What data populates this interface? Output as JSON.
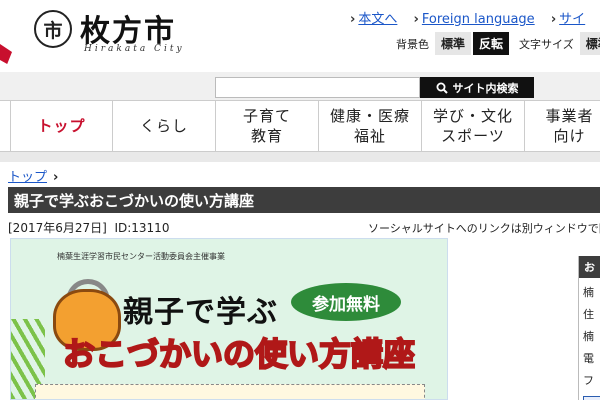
{
  "header": {
    "logo_mark": "市",
    "logo_text": "枚方市",
    "logo_sub": "Hirakata City",
    "links": [
      {
        "label": "本文へ"
      },
      {
        "label": "Foreign language"
      },
      {
        "label": "サイ"
      }
    ],
    "bg_color_label": "背景色",
    "bg_standard": "標準",
    "bg_reverse": "反転",
    "font_size_label": "文字サイズ",
    "font_standard": "標準"
  },
  "search": {
    "input_value": "",
    "button_label": "サイト内検索"
  },
  "nav": [
    {
      "line1": "トップ",
      "line2": ""
    },
    {
      "line1": "くらし",
      "line2": ""
    },
    {
      "line1": "子育て",
      "line2": "教育"
    },
    {
      "line1": "健康・医療",
      "line2": "福祉"
    },
    {
      "line1": "学び・文化",
      "line2": "スポーツ"
    },
    {
      "line1": "事業者",
      "line2": "向け"
    }
  ],
  "breadcrumb": {
    "home": "トップ",
    "sep": "›"
  },
  "page": {
    "title": "親子で学ぶおこづかいの使い方講座",
    "date": "[2017年6月27日]",
    "id": "ID:13110",
    "social_note": "ソーシャルサイトへのリンクは別ウィンドウで開き"
  },
  "flyer": {
    "organizer": "楠葉生涯学習市民センター活動委員会主催事業",
    "heading1": "親子で学ぶ",
    "badge": "参加無料",
    "heading2": "おこづかいの使い方講座"
  },
  "sidebar": {
    "head": "お",
    "lines": [
      "楠",
      "住",
      "楠",
      "電",
      "フ"
    ]
  },
  "colors": {
    "accent_red": "#c8102e",
    "link_blue": "#1a56c8",
    "title_bar": "#3d3d3d",
    "flyer_bg": "#dff4e6",
    "badge_green": "#2e8b3a"
  }
}
